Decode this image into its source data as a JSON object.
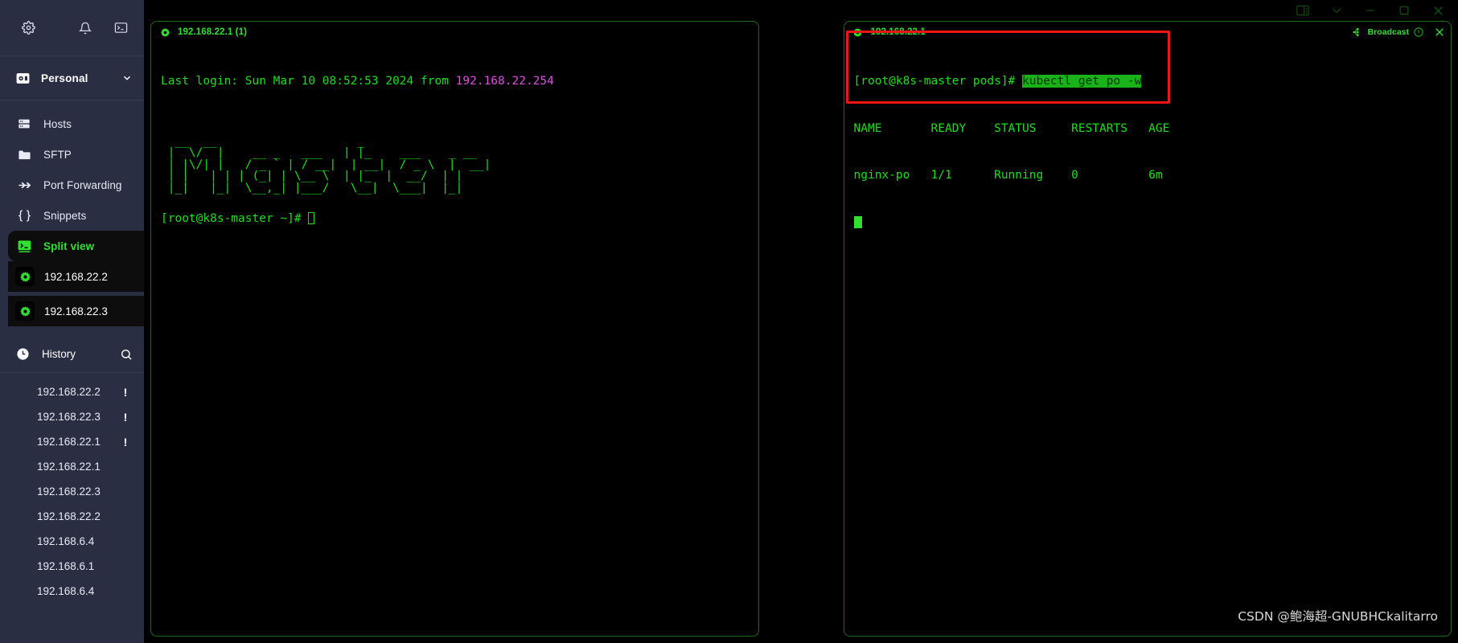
{
  "window": {
    "controls": [
      {
        "name": "layout-toggle",
        "glyph": "layout"
      },
      {
        "name": "chevron-down",
        "glyph": "chevron"
      },
      {
        "name": "minimize",
        "glyph": "minus"
      },
      {
        "name": "maximize",
        "glyph": "square"
      },
      {
        "name": "close",
        "glyph": "x"
      }
    ]
  },
  "sidebar": {
    "toolbar": {
      "settings_icon": "gear-icon",
      "notifications_icon": "bell-icon",
      "terminal_icon": "terminal-icon"
    },
    "account": {
      "icon": "vault-icon",
      "label": "Personal",
      "chevron": "chevron-down-icon"
    },
    "nav": [
      {
        "label": "Hosts",
        "icon": "server-icon",
        "active": false
      },
      {
        "label": "SFTP",
        "icon": "folder-icon",
        "active": false
      },
      {
        "label": "Port Forwarding",
        "icon": "forward-icon",
        "active": false
      },
      {
        "label": "Snippets",
        "icon": "braces-icon",
        "active": false
      },
      {
        "label": "Split view",
        "icon": "split-view-icon",
        "active": true
      }
    ],
    "hosts": [
      {
        "label": "192.168.22.2",
        "icon": "gear-green-icon"
      },
      {
        "label": "192.168.22.3",
        "icon": "gear-green-icon"
      }
    ],
    "history": {
      "icon": "clock-icon",
      "label": "History",
      "search_icon": "search-icon",
      "items": [
        {
          "label": "192.168.22.2",
          "warn": "!"
        },
        {
          "label": "192.168.22.3",
          "warn": "!"
        },
        {
          "label": "192.168.22.1",
          "warn": "!"
        },
        {
          "label": "192.168.22.1",
          "warn": ""
        },
        {
          "label": "192.168.22.3",
          "warn": ""
        },
        {
          "label": "192.168.22.2",
          "warn": ""
        },
        {
          "label": "192.168.6.4",
          "warn": ""
        },
        {
          "label": "192.168.6.1",
          "warn": ""
        },
        {
          "label": "192.168.6.4",
          "warn": ""
        }
      ]
    }
  },
  "panes": {
    "left": {
      "tab_title": "192.168.22.1 (1)",
      "tab_icon": "gear-green-icon",
      "login_line_prefix": "Last login: Sun Mar 10 08:52:53 2024 from ",
      "login_line_host": "192.168.22.254",
      "ascii_banner": "  __  __                    _\n |  \\/  |    __ _   ___   | |_    ___    _ __\n | |\\/| |   / _ ` | / __|  | __|  / _ \\  |  __|\n | |   | | | (_| | \\__ \\  | |_  |  __/  | |\n |_|   |_|  \\__,_| |___/   \\__|  \\___|  |_|",
      "prompt": "[root@k8s-master ~]# ",
      "cursor": "hollow"
    },
    "right": {
      "tab_title": "192.168.22.1",
      "tab_icon": "gear-green-icon",
      "broadcast_label": "Broadcast",
      "broadcast_icon": "broadcast-icon",
      "broadcast_toggle_icon": "toggle-icon",
      "close_icon": "close-icon",
      "prompt": "[root@k8s-master pods]# ",
      "command": "kubectl get po -w",
      "table": {
        "headers": [
          "NAME",
          "READY",
          "STATUS",
          "RESTARTS",
          "AGE"
        ],
        "rows": [
          [
            "nginx-po",
            "1/1",
            "Running",
            "0",
            "6m"
          ]
        ]
      },
      "cursor": "solid"
    }
  },
  "annotation": {
    "highlight_color": "#f01515"
  },
  "watermark": "CSDN @鲍海超-GNUBHCkalitarro"
}
